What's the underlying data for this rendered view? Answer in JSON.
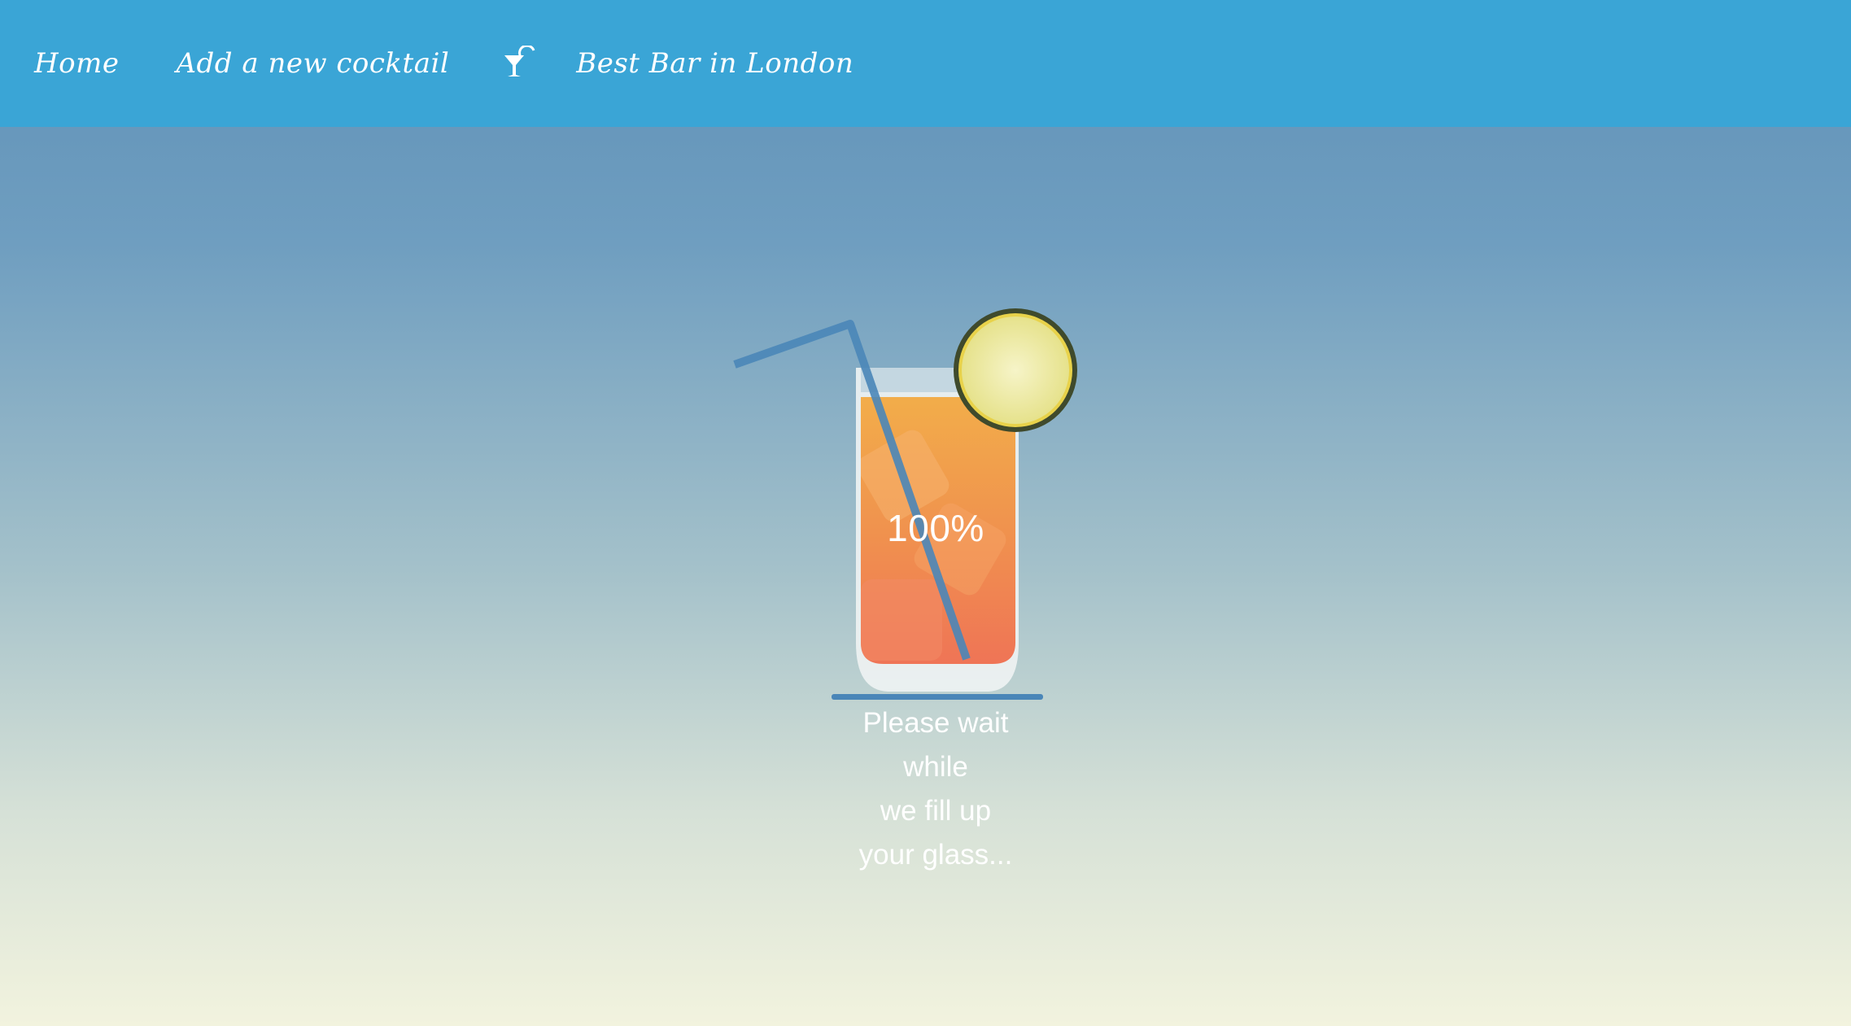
{
  "nav": {
    "home_label": "Home",
    "add_label": "Add a new cocktail",
    "brand_icon": "cocktail-glass-icon",
    "brand_label": "Best Bar in London"
  },
  "loader": {
    "percent_label": "100%",
    "progress_fraction": 1.0,
    "wait_lines": [
      "Please wait",
      "while",
      "we fill up",
      "your glass..."
    ]
  },
  "colors": {
    "navbar": "#3aa5d6",
    "drink_top": "#f0a84a",
    "drink_bottom": "#ef7556",
    "straw": "#4a86b8",
    "lemon": "#ece99a",
    "lemon_rind": "#3f4a2c"
  }
}
